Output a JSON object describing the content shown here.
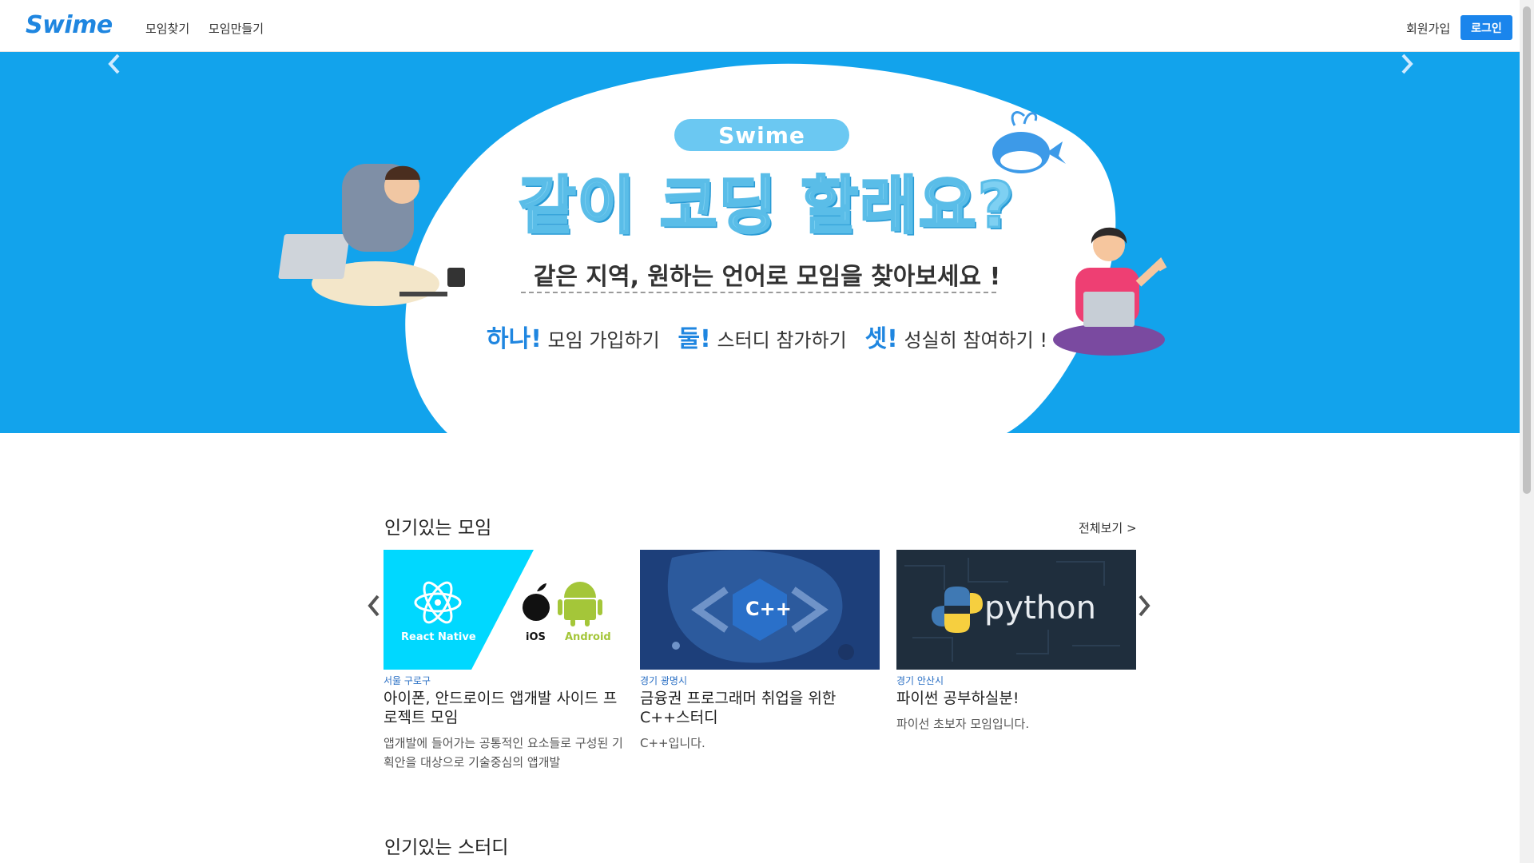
{
  "header": {
    "logo": "Swime",
    "nav": [
      "모임찾기",
      "모임만들기"
    ],
    "signup": "회원가입",
    "login": "로그인"
  },
  "banner": {
    "pill": "Swime",
    "headline": "같이 코딩 할래요?",
    "subhead": "같은 지역, 원하는 언어로 모임을 찾아보세요 !",
    "steps": [
      {
        "em": "하나!",
        "text": "모임 가입하기"
      },
      {
        "em": "둘!",
        "text": "스터디 참가하기"
      },
      {
        "em": "셋!",
        "text": "성실히 참여하기 !"
      }
    ],
    "colors": {
      "background": "#12a3ec",
      "accent": "#1f86e0"
    }
  },
  "popular_groups": {
    "title": "인기있는 모임",
    "see_all": "전체보기 >",
    "cards": [
      {
        "location": "서울 구로구",
        "title": "아이폰, 안드로이드 앱개발 사이드 프로젝트 모임",
        "description": "앱개발에 들어가는 공통적인 요소들로 구성된 기획안을 대상으로 기술중심의 앱개발",
        "image": {
          "left_text": "React Native",
          "mid_text": "iOS",
          "right_text": "Android"
        }
      },
      {
        "location": "경기 광명시",
        "title": "금융권 프로그래머 취업을 위한 C++스터디",
        "description": "C++입니다.",
        "image": {
          "text": "C++"
        }
      },
      {
        "location": "경기 안산시",
        "title": "파이썬 공부하실분!",
        "description": "파이선 초보자 모임입니다.",
        "image": {
          "text": "python"
        }
      }
    ]
  },
  "popular_studies": {
    "title": "인기있는 스터디"
  }
}
